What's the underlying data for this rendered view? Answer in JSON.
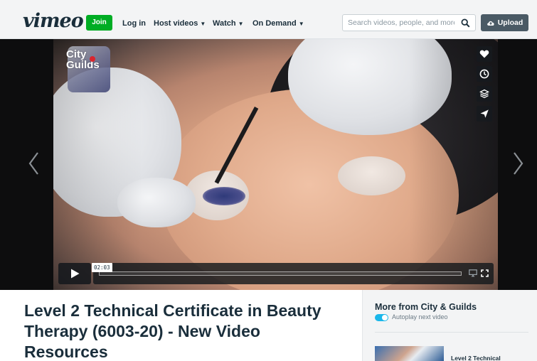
{
  "nav": {
    "logo": "vimeo",
    "join": "Join",
    "login": "Log in",
    "host_videos": "Host videos",
    "watch": "Watch",
    "on_demand": "On Demand",
    "search_placeholder": "Search videos, people, and more",
    "upload": "Upload"
  },
  "player": {
    "brand_line1": "City",
    "brand_line2": "Guilds",
    "time": "02:03",
    "progress": 0.0,
    "side_icons": [
      "heart-icon",
      "clock-icon",
      "layers-icon",
      "send-icon"
    ]
  },
  "video": {
    "title": "Level 2 Technical Certificate in Beauty Therapy (6003-20) - New Video Resources"
  },
  "sidebar": {
    "heading": "More from City & Guilds",
    "autoplay_label": "Autoplay next video",
    "autoplay_on": true,
    "next_title": "Level 2 Technical"
  },
  "colors": {
    "brand_green": "#00ad24",
    "toggle_blue": "#1ab7ea",
    "text_dark": "#1a2e3b"
  }
}
